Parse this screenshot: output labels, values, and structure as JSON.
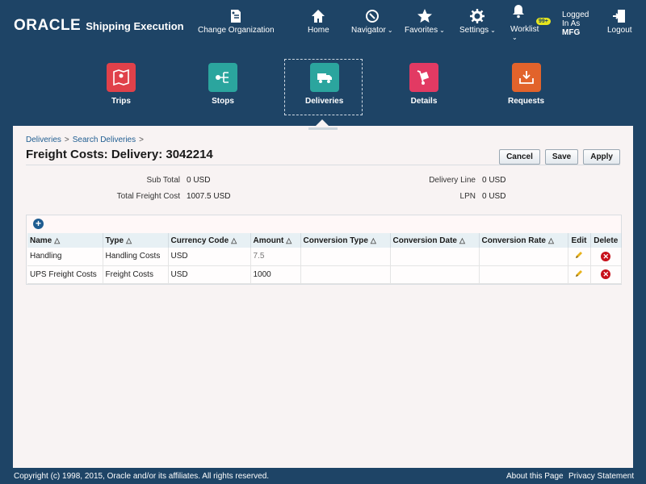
{
  "header": {
    "logo": "ORACLE",
    "app_name": "Shipping Execution",
    "nav": {
      "change_org": "Change Organization",
      "home": "Home",
      "navigator": "Navigator",
      "favorites": "Favorites",
      "settings": "Settings",
      "worklist": "Worklist",
      "worklist_badge": "99+",
      "logged_in_line1": "Logged",
      "logged_in_line2": "In As",
      "user": "MFG",
      "logout": "Logout"
    }
  },
  "springboard": {
    "tiles": [
      {
        "label": "Trips",
        "color": "#e0414a"
      },
      {
        "label": "Stops",
        "color": "#2ba59e"
      },
      {
        "label": "Deliveries",
        "color": "#2ba59e"
      },
      {
        "label": "Details",
        "color": "#e23a63"
      },
      {
        "label": "Requests",
        "color": "#e2632b"
      }
    ],
    "selected": "Deliveries"
  },
  "breadcrumb": {
    "items": [
      "Deliveries",
      "Search Deliveries"
    ],
    "separator": ">"
  },
  "page": {
    "title": "Freight Costs: Delivery: 3042214",
    "actions": {
      "cancel": "Cancel",
      "save": "Save",
      "apply": "Apply"
    }
  },
  "summary": {
    "sub_total_label": "Sub Total",
    "sub_total_value": "0 USD",
    "total_label": "Total Freight Cost",
    "total_value": "1007.5 USD",
    "delivery_line_label": "Delivery Line",
    "delivery_line_value": "0 USD",
    "lpn_label": "LPN",
    "lpn_value": "0 USD"
  },
  "table": {
    "columns": {
      "name": "Name",
      "type": "Type",
      "currency": "Currency Code",
      "amount": "Amount",
      "conv_type": "Conversion Type",
      "conv_date": "Conversion Date",
      "conv_rate": "Conversion Rate",
      "edit": "Edit",
      "delete": "Delete"
    },
    "rows": [
      {
        "name": "Handling",
        "type": "Handling Costs",
        "currency": "USD",
        "amount": "7.5",
        "conv_type": "",
        "conv_date": "",
        "conv_rate": ""
      },
      {
        "name": "UPS Freight Costs",
        "type": "Freight Costs",
        "currency": "USD",
        "amount": "1000",
        "conv_type": "",
        "conv_date": "",
        "conv_rate": ""
      }
    ]
  },
  "footer": {
    "copyright": "Copyright (c) 1998, 2015, Oracle and/or its affiliates. All rights reserved.",
    "about": "About this Page",
    "privacy": "Privacy Statement"
  },
  "colors": {
    "header_bg": "#1e4466",
    "panel_bg": "#f8f3f3",
    "link": "#1f5d91",
    "delete": "#c7101a"
  }
}
